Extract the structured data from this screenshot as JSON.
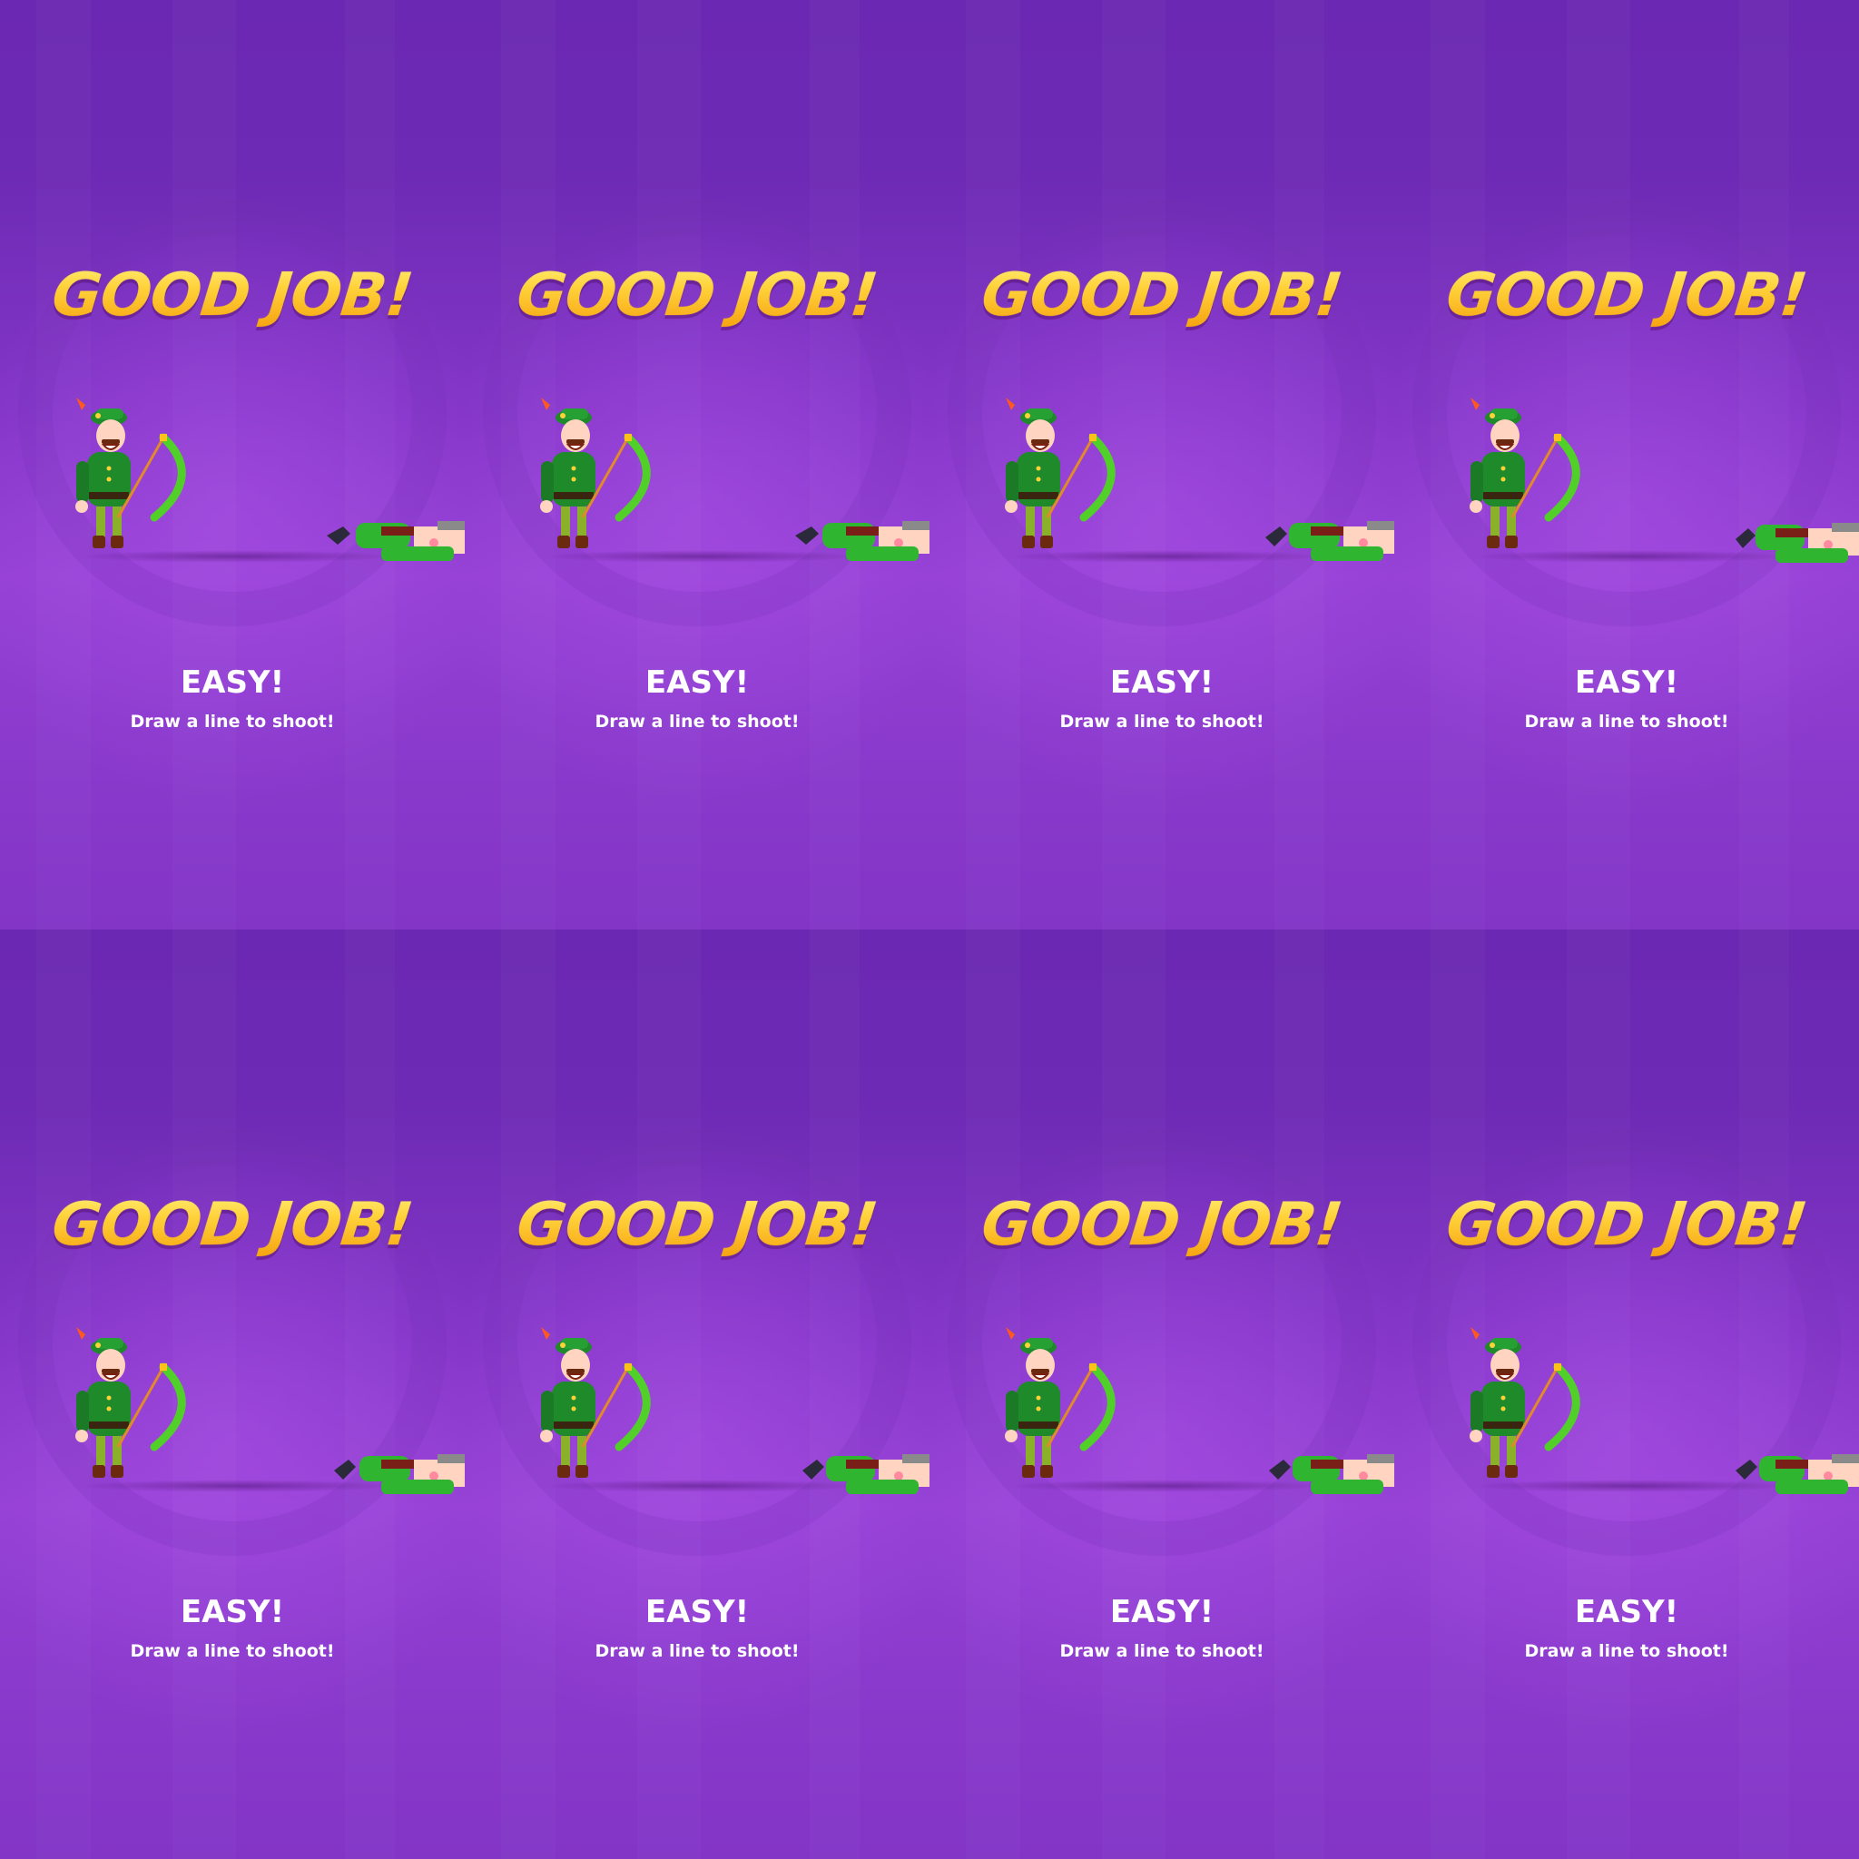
{
  "screens": [
    {
      "title": "GOOD JOB!",
      "difficulty": "EASY!",
      "hint": "Draw a line to shoot!"
    },
    {
      "title": "GOOD JOB!",
      "difficulty": "EASY!",
      "hint": "Draw a line to shoot!"
    },
    {
      "title": "GOOD JOB!",
      "difficulty": "EASY!",
      "hint": "Draw a line to shoot!"
    },
    {
      "title": "GOOD JOB!",
      "difficulty": "EASY!",
      "hint": "Draw a line to shoot!"
    },
    {
      "title": "GOOD JOB!",
      "difficulty": "EASY!",
      "hint": "Draw a line to shoot!"
    },
    {
      "title": "GOOD JOB!",
      "difficulty": "EASY!",
      "hint": "Draw a line to shoot!"
    },
    {
      "title": "GOOD JOB!",
      "difficulty": "EASY!",
      "hint": "Draw a line to shoot!"
    },
    {
      "title": "GOOD JOB!",
      "difficulty": "EASY!",
      "hint": "Draw a line to shoot!"
    }
  ],
  "colors": {
    "background": "#8436c8",
    "title_gold": "#ffc21a",
    "text": "#ffffff",
    "archer_green": "#1f8a2a",
    "bow_green": "#52d02a",
    "enemy_green": "#2fb52f"
  },
  "icons": {
    "player": "archer-icon",
    "enemy": "defeated-enemy-icon"
  }
}
